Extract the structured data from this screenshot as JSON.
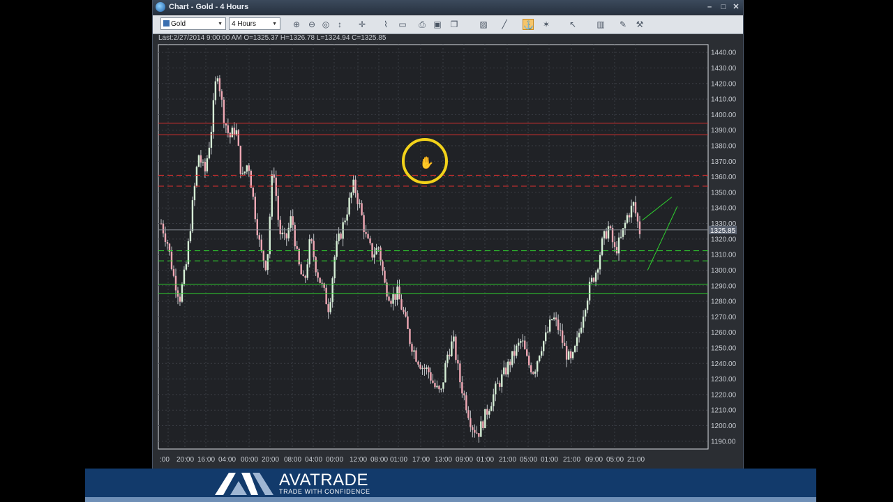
{
  "window": {
    "title": "Chart - Gold - 4 Hours",
    "minimize_icon": "–",
    "restore_icon": "□",
    "close_icon": "✕"
  },
  "toolbar": {
    "symbol_value": "Gold",
    "timeframe_value": "4 Hours",
    "caret": "▼",
    "tools": [
      {
        "name": "zoom-in-icon",
        "glyph": "⊕"
      },
      {
        "name": "zoom-out-icon",
        "glyph": "⊖"
      },
      {
        "name": "zoom-fit-icon",
        "glyph": "◎"
      },
      {
        "name": "scroll-icon",
        "glyph": "↕"
      },
      {
        "name": "crosshair-icon",
        "glyph": "✛"
      },
      {
        "name": "indicators-icon",
        "glyph": "⌇"
      },
      {
        "name": "chart-type-icon",
        "glyph": "▭"
      },
      {
        "name": "print-icon",
        "glyph": "⎙"
      },
      {
        "name": "save-icon",
        "glyph": "▣"
      },
      {
        "name": "copy-icon",
        "glyph": "❐"
      },
      {
        "name": "export-image-icon",
        "glyph": "▨"
      },
      {
        "name": "line-draw-icon",
        "glyph": "╱"
      },
      {
        "name": "magnet-icon",
        "glyph": "⚓"
      },
      {
        "name": "fibonacci-icon",
        "glyph": "✶"
      },
      {
        "name": "pointer-icon",
        "glyph": "↖"
      },
      {
        "name": "templates-icon",
        "glyph": "▥"
      },
      {
        "name": "notes-icon",
        "glyph": "✎"
      },
      {
        "name": "settings-icon",
        "glyph": "⚒"
      }
    ]
  },
  "info": {
    "last_bar": "Last:2/27/2014 9:00:00 AM O=1325.37 H=1326.78 L=1324.94 C=1325.85"
  },
  "chart_data": {
    "type": "candlestick",
    "symbol": "Gold",
    "timeframe": "4 Hours",
    "ylim": [
      1185,
      1445
    ],
    "y_ticks": [
      "1440.00",
      "1430.00",
      "1420.00",
      "1410.00",
      "1400.00",
      "1390.00",
      "1380.00",
      "1370.00",
      "1360.00",
      "1350.00",
      "1340.00",
      "1330.00",
      "1320.00",
      "1310.00",
      "1300.00",
      "1290.00",
      "1280.00",
      "1270.00",
      "1260.00",
      "1250.00",
      "1240.00",
      "1230.00",
      "1220.00",
      "1210.00",
      "1200.00",
      "1190.00"
    ],
    "x_ticks": [
      ":00",
      "20:00",
      "16:00",
      "04:00",
      "00:00",
      "20:00",
      "08:00",
      "04:00",
      "00:00",
      "12:00",
      "08:00",
      "01:00",
      "17:00",
      "13:00",
      "09:00",
      "01:00",
      "21:00",
      "05:00",
      "01:00",
      "21:00",
      "09:00",
      "05:00",
      "21:00"
    ],
    "current_price_label": "1325.85",
    "current_price": 1325.85,
    "price_path": [
      1330,
      1318,
      1296,
      1282,
      1302,
      1340,
      1375,
      1362,
      1388,
      1430,
      1400,
      1385,
      1392,
      1358,
      1370,
      1340,
      1312,
      1302,
      1370,
      1325,
      1318,
      1335,
      1305,
      1290,
      1320,
      1300,
      1288,
      1275,
      1312,
      1325,
      1340,
      1355,
      1340,
      1320,
      1310,
      1315,
      1290,
      1282,
      1285,
      1272,
      1255,
      1245,
      1238,
      1235,
      1225,
      1220,
      1245,
      1255,
      1230,
      1215,
      1200,
      1195,
      1205,
      1215,
      1225,
      1232,
      1240,
      1248,
      1255,
      1240,
      1235,
      1250,
      1258,
      1270,
      1262,
      1248,
      1240,
      1255,
      1275,
      1290,
      1300,
      1318,
      1328,
      1312,
      1320,
      1335,
      1342,
      1325
    ],
    "horizontal_lines": [
      {
        "price": 1394.5,
        "color": "#e03030",
        "style": "solid"
      },
      {
        "price": 1387,
        "color": "#e03030",
        "style": "solid"
      },
      {
        "price": 1361,
        "color": "#e03030",
        "style": "dashed"
      },
      {
        "price": 1354,
        "color": "#e03030",
        "style": "dashed"
      },
      {
        "price": 1312.5,
        "color": "#2fd02f",
        "style": "dashed"
      },
      {
        "price": 1306,
        "color": "#2fd02f",
        "style": "dashed"
      },
      {
        "price": 1291,
        "color": "#2fd02f",
        "style": "solid"
      },
      {
        "price": 1285,
        "color": "#2fd02f",
        "style": "solid"
      }
    ],
    "trend_lines": [
      {
        "from": [
          0.88,
          1332
        ],
        "to": [
          0.934,
          1347
        ],
        "color": "#2fd02f"
      },
      {
        "from": [
          0.89,
          1300
        ],
        "to": [
          0.944,
          1341
        ],
        "color": "#2fd02f"
      }
    ],
    "colors": {
      "background": "#202226",
      "grid": "#3a3d44",
      "axis_text": "#c8ccd2",
      "bull": "#d6f0d6",
      "bear": "#f0a8b4",
      "wick": "#c0c4c8"
    }
  },
  "branding": {
    "name": "AVATRADE",
    "tagline": "TRADE WITH CONFIDENCE"
  }
}
